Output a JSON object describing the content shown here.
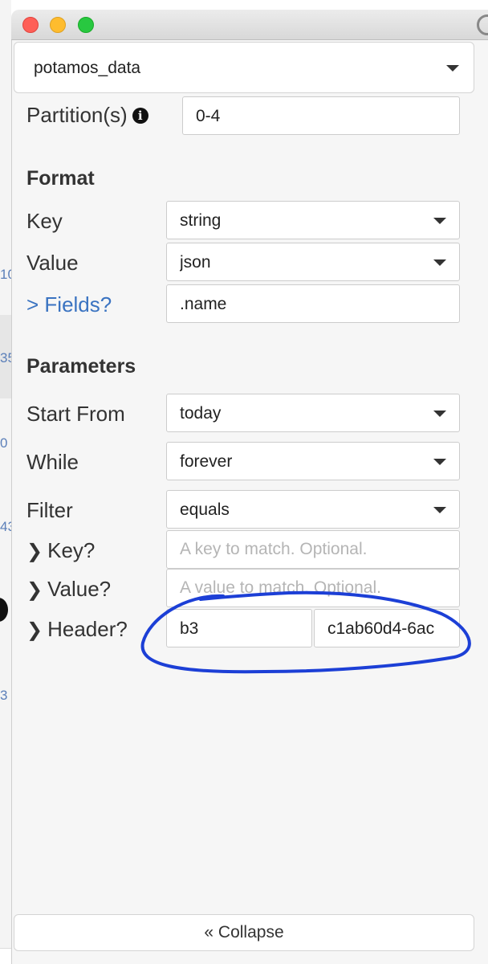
{
  "window": {
    "controls": [
      "close",
      "minimize",
      "maximize"
    ]
  },
  "background": {
    "side_numbers": [
      "10",
      "35",
      "0",
      "43",
      "3"
    ],
    "bottom_link": "user-messages"
  },
  "topic": {
    "selected": "potamos_data"
  },
  "partitions": {
    "label": "Partition(s)",
    "value": "0-4",
    "info_icon": "info-circle-icon"
  },
  "format": {
    "heading": "Format",
    "key_label": "Key",
    "key_value": "string",
    "value_label": "Value",
    "value_value": "json",
    "fields_label": "> Fields?",
    "fields_value": ".name"
  },
  "parameters": {
    "heading": "Parameters",
    "start_label": "Start From",
    "start_value": "today",
    "while_label": "While",
    "while_value": "forever",
    "filter_label": "Filter",
    "filter_value": "equals",
    "key_label": "Key?",
    "key_placeholder": "A key to match. Optional.",
    "value_label": "Value?",
    "value_placeholder": "A value to match. Optional.",
    "header_label": "Header?",
    "header_name": "b3",
    "header_value": "c1ab60d4-6ac"
  },
  "collapse": {
    "label": "Collapse",
    "icon": "double-chevron-left-icon"
  },
  "colors": {
    "link": "#3a73c1",
    "annotation": "#1c3fd6",
    "panel_bg": "#f6f6f6"
  }
}
